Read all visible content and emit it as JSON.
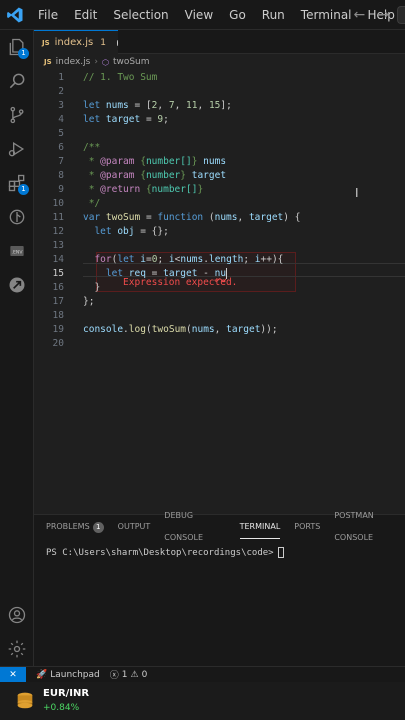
{
  "menu": [
    "File",
    "Edit",
    "Selection",
    "View",
    "Go",
    "Run",
    "Terminal",
    "Help"
  ],
  "tab": {
    "badge": "JS",
    "name": "index.js",
    "problems": "1"
  },
  "breadcrumb": {
    "file": "index.js",
    "symbol": "twoSum"
  },
  "editor": {
    "lines": [
      {
        "n": "1",
        "tokens": [
          {
            "t": "// 1. Two Sum",
            "c": "cm"
          }
        ]
      },
      {
        "n": "2",
        "tokens": []
      },
      {
        "n": "3",
        "tokens": [
          {
            "t": "let ",
            "c": "kw"
          },
          {
            "t": "nums",
            "c": "var"
          },
          {
            "t": " = [",
            "c": ""
          },
          {
            "t": "2",
            "c": "num"
          },
          {
            "t": ", ",
            "c": ""
          },
          {
            "t": "7",
            "c": "num"
          },
          {
            "t": ", ",
            "c": ""
          },
          {
            "t": "11",
            "c": "num"
          },
          {
            "t": ", ",
            "c": ""
          },
          {
            "t": "15",
            "c": "num"
          },
          {
            "t": "];",
            "c": ""
          }
        ]
      },
      {
        "n": "4",
        "tokens": [
          {
            "t": "let ",
            "c": "kw"
          },
          {
            "t": "target",
            "c": "var"
          },
          {
            "t": " = ",
            "c": ""
          },
          {
            "t": "9",
            "c": "num"
          },
          {
            "t": ";",
            "c": ""
          }
        ]
      },
      {
        "n": "5",
        "tokens": []
      },
      {
        "n": "6",
        "tokens": [
          {
            "t": "/**",
            "c": "cm"
          }
        ]
      },
      {
        "n": "7",
        "tokens": [
          {
            "t": " * ",
            "c": "cm"
          },
          {
            "t": "@param",
            "c": "ctrl"
          },
          {
            "t": " {",
            "c": "cm"
          },
          {
            "t": "number[]",
            "c": "type"
          },
          {
            "t": "} ",
            "c": "cm"
          },
          {
            "t": "nums",
            "c": "var"
          }
        ]
      },
      {
        "n": "8",
        "tokens": [
          {
            "t": " * ",
            "c": "cm"
          },
          {
            "t": "@param",
            "c": "ctrl"
          },
          {
            "t": " {",
            "c": "cm"
          },
          {
            "t": "number",
            "c": "type"
          },
          {
            "t": "} ",
            "c": "cm"
          },
          {
            "t": "target",
            "c": "var"
          }
        ]
      },
      {
        "n": "9",
        "tokens": [
          {
            "t": " * ",
            "c": "cm"
          },
          {
            "t": "@return",
            "c": "ctrl"
          },
          {
            "t": " {",
            "c": "cm"
          },
          {
            "t": "number[]",
            "c": "type"
          },
          {
            "t": "}",
            "c": "cm"
          }
        ]
      },
      {
        "n": "10",
        "tokens": [
          {
            "t": " */",
            "c": "cm"
          }
        ]
      },
      {
        "n": "11",
        "tokens": [
          {
            "t": "var ",
            "c": "kw"
          },
          {
            "t": "twoSum",
            "c": "fn"
          },
          {
            "t": " = ",
            "c": ""
          },
          {
            "t": "function",
            "c": "kw"
          },
          {
            "t": " (",
            "c": ""
          },
          {
            "t": "nums",
            "c": "var"
          },
          {
            "t": ", ",
            "c": ""
          },
          {
            "t": "target",
            "c": "var"
          },
          {
            "t": ") {",
            "c": ""
          }
        ]
      },
      {
        "n": "12",
        "tokens": [
          {
            "t": "  let ",
            "c": "kw"
          },
          {
            "t": "obj",
            "c": "var"
          },
          {
            "t": " = {};",
            "c": ""
          }
        ]
      },
      {
        "n": "13",
        "tokens": []
      },
      {
        "n": "14",
        "tokens": [
          {
            "t": "  for",
            "c": "ctrl"
          },
          {
            "t": "(",
            "c": ""
          },
          {
            "t": "let ",
            "c": "kw"
          },
          {
            "t": "i",
            "c": "var"
          },
          {
            "t": "=",
            "c": ""
          },
          {
            "t": "0",
            "c": "num"
          },
          {
            "t": "; ",
            "c": ""
          },
          {
            "t": "i",
            "c": "var"
          },
          {
            "t": "<",
            "c": ""
          },
          {
            "t": "nums",
            "c": "var"
          },
          {
            "t": ".",
            "c": ""
          },
          {
            "t": "length",
            "c": "var"
          },
          {
            "t": "; ",
            "c": ""
          },
          {
            "t": "i",
            "c": "var"
          },
          {
            "t": "++){",
            "c": ""
          }
        ]
      },
      {
        "n": "15",
        "tokens": [
          {
            "t": "    let ",
            "c": "kw"
          },
          {
            "t": "req",
            "c": "var"
          },
          {
            "t": " = ",
            "c": ""
          },
          {
            "t": "target",
            "c": "var"
          },
          {
            "t": " - ",
            "c": ""
          },
          {
            "t": "nu",
            "c": "var"
          }
        ]
      },
      {
        "n": "16",
        "tokens": [
          {
            "t": "  }",
            "c": ""
          }
        ]
      },
      {
        "n": "17",
        "tokens": [
          {
            "t": "};",
            "c": ""
          }
        ]
      },
      {
        "n": "18",
        "tokens": []
      },
      {
        "n": "19",
        "tokens": [
          {
            "t": "console",
            "c": "var"
          },
          {
            "t": ".",
            "c": ""
          },
          {
            "t": "log",
            "c": "fn"
          },
          {
            "t": "(",
            "c": ""
          },
          {
            "t": "twoSum",
            "c": "fn"
          },
          {
            "t": "(",
            "c": ""
          },
          {
            "t": "nums",
            "c": "var"
          },
          {
            "t": ", ",
            "c": ""
          },
          {
            "t": "target",
            "c": "var"
          },
          {
            "t": "));",
            "c": ""
          }
        ]
      },
      {
        "n": "20",
        "tokens": []
      }
    ],
    "active_line": "15",
    "inline_error": "Expression expected."
  },
  "panel": {
    "tabs": [
      {
        "label": "PROBLEMS",
        "badge": "1"
      },
      {
        "label": "OUTPUT"
      },
      {
        "label": "DEBUG CONSOLE"
      },
      {
        "label": "TERMINAL",
        "active": true
      },
      {
        "label": "PORTS"
      },
      {
        "label": "POSTMAN CONSOLE"
      }
    ],
    "terminal_prompt": "PS C:\\Users\\sharm\\Desktop\\recordings\\code>"
  },
  "status": {
    "launchpad": "Launchpad",
    "errors": "1",
    "warnings": "0"
  },
  "ticker": {
    "pair": "EUR/INR",
    "change": "+0.84%"
  },
  "colors": {
    "accent": "#0078d4",
    "error": "#f14c4c",
    "positive": "#4cd964"
  }
}
